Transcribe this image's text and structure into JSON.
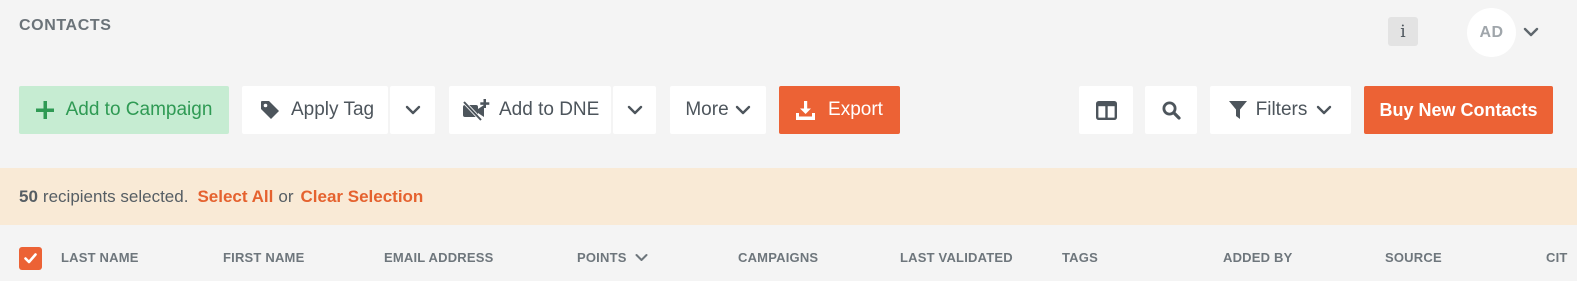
{
  "header": {
    "title": "CONTACTS",
    "info_icon_text": "i",
    "avatar_initials": "AD"
  },
  "toolbar": {
    "add_to_campaign": "Add to Campaign",
    "apply_tag": "Apply Tag",
    "add_to_dne": "Add to DNE",
    "more": "More",
    "export": "Export",
    "filters": "Filters",
    "buy_new_contacts": "Buy New Contacts"
  },
  "selection": {
    "count": "50",
    "text": "recipients selected.",
    "select_all": "Select All",
    "or": "or",
    "clear_selection": "Clear Selection"
  },
  "table": {
    "all_selected": true,
    "columns": [
      {
        "label": "LAST NAME"
      },
      {
        "label": "FIRST NAME"
      },
      {
        "label": "EMAIL ADDRESS"
      },
      {
        "label": "POINTS",
        "sortable": true
      },
      {
        "label": "CAMPAIGNS"
      },
      {
        "label": "LAST VALIDATED"
      },
      {
        "label": "TAGS"
      },
      {
        "label": "ADDED BY"
      },
      {
        "label": "SOURCE"
      },
      {
        "label": "CIT"
      }
    ]
  },
  "colors": {
    "accent": "#ec6235",
    "campaign_bg": "#c6ecd2",
    "campaign_text": "#2f9a54",
    "selection_bg": "#f9ead6",
    "page_bg": "#f4f4f4"
  },
  "icons": [
    "info-icon",
    "chevron-down-icon",
    "plus-icon",
    "tag-icon",
    "video-off-plus-icon",
    "download-icon",
    "columns-icon",
    "search-icon",
    "filter-icon",
    "checkmark-icon"
  ]
}
